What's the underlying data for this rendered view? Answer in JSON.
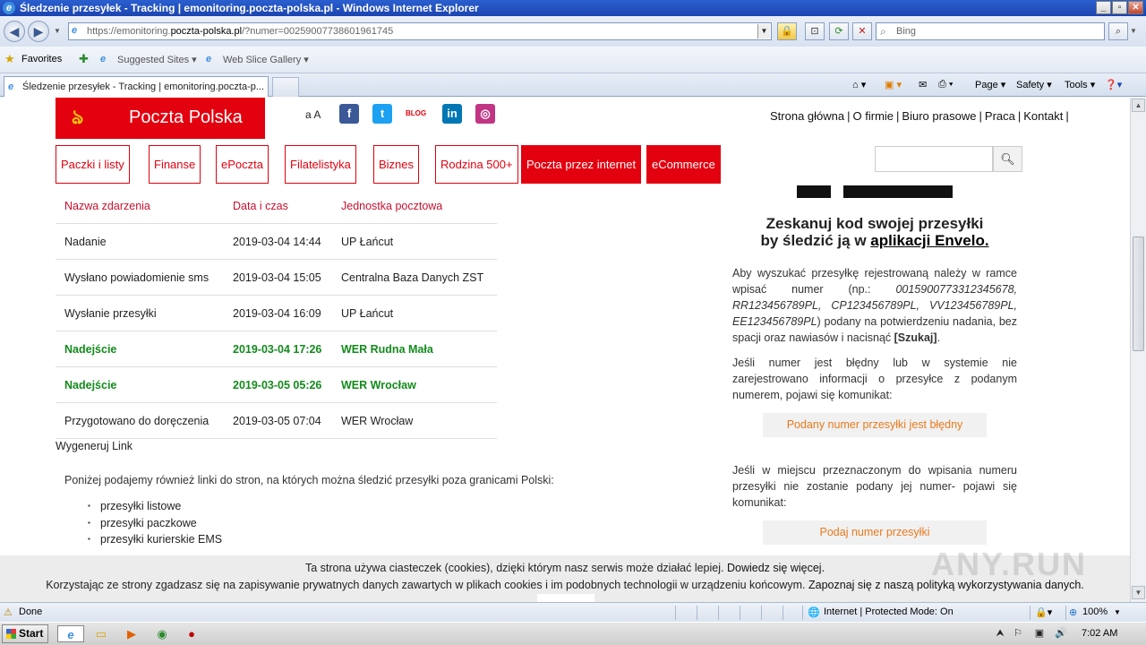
{
  "window": {
    "title": "Śledzenie przesyłek - Tracking | emonitoring.poczta-polska.pl - Windows Internet Explorer",
    "min": "_",
    "max": "▫",
    "close": "✕"
  },
  "addressbar": {
    "url_prefix": "https://emonitoring.",
    "url_domain": "poczta-polska.pl",
    "url_rest": "/?numer=00259007738601961745",
    "search_placeholder": "Bing"
  },
  "favorites": {
    "favorites_label": "Favorites",
    "suggested": "Suggested Sites ▾",
    "webslice": "Web Slice Gallery ▾"
  },
  "tabs": {
    "active_tab": "Śledzenie przesyłek - Tracking | emonitoring.poczta-p...",
    "commands": [
      "Page ▾",
      "Safety ▾",
      "Tools ▾"
    ]
  },
  "site": {
    "logo_text": "Poczta Polska",
    "font_toggle": "a A",
    "social": [
      {
        "icon": "facebook-icon",
        "glyph": "f",
        "color": "#3b5998"
      },
      {
        "icon": "twitter-icon",
        "glyph": "t",
        "color": "#1da1f2"
      },
      {
        "icon": "blog-icon",
        "glyph": "BLOG",
        "color": "#e3000f"
      },
      {
        "icon": "linkedin-icon",
        "glyph": "in",
        "color": "#0077b5"
      },
      {
        "icon": "instagram-icon",
        "glyph": "◎",
        "color": "#c13584"
      }
    ],
    "top_links": [
      "Strona główna",
      "O firmie",
      "Biuro prasowe",
      "Praca",
      "Kontakt"
    ],
    "menu": [
      {
        "label": "Paczki i listy",
        "active": false
      },
      {
        "label": "Finanse",
        "active": false
      },
      {
        "label": "ePoczta",
        "active": false
      },
      {
        "label": "Filatelistyka",
        "active": false
      },
      {
        "label": "Biznes",
        "active": false
      },
      {
        "label": "Rodzina 500+",
        "active": false
      },
      {
        "label": "Poczta przez internet",
        "active": true
      },
      {
        "label": "eCommerce",
        "active": true
      }
    ],
    "search_icon": "search-icon"
  },
  "events": {
    "headers": [
      "Nazwa zdarzenia",
      "Data i czas",
      "Jednostka pocztowa"
    ],
    "rows": [
      {
        "name": "Nadanie",
        "date": "2019-03-04 14:44",
        "unit": "UP Łańcut",
        "highlight": false
      },
      {
        "name": "Wysłano powiadomienie sms",
        "date": "2019-03-04 15:05",
        "unit": "Centralna Baza Danych ZST",
        "highlight": false
      },
      {
        "name": "Wysłanie przesyłki",
        "date": "2019-03-04 16:09",
        "unit": "UP Łańcut",
        "highlight": false
      },
      {
        "name": "Nadejście",
        "date": "2019-03-04 17:26",
        "unit": "WER Rudna Mała",
        "highlight": true
      },
      {
        "name": "Nadejście",
        "date": "2019-03-05 05:26",
        "unit": "WER Wrocław",
        "highlight": true
      },
      {
        "name": "Przygotowano do doręczenia",
        "date": "2019-03-05 07:04",
        "unit": "WER Wrocław",
        "highlight": false
      }
    ],
    "generate_link": "Wygeneruj Link"
  },
  "foreign": {
    "intro": "Poniżej podajemy również linki do stron, na których można śledzić przesyłki poza granicami Polski:",
    "items": [
      "przesyłki listowe",
      "przesyłki paczkowe",
      "przesyłki kurierskie EMS"
    ]
  },
  "sidebar": {
    "scan_line1": "Zeskanuj kod swojej przesyłki",
    "scan_line2_prefix": "by śledzić ją w ",
    "scan_line2_link": "aplikacji Envelo.",
    "p1_a": "Aby wyszukać przesyłkę rejestrowaną należy w ramce wpisać numer (np.: ",
    "p1_examples": "00159007733123456​78, RR123456789PL, CP123456789PL, VV123456789PL, EE123456789PL",
    "p1_b": ") podany na potwierdzeniu nadania, bez spacji oraz nawiasów i nacisnąć ",
    "p1_button": "[Szukaj]",
    "p1_end": ".",
    "p2": "Jeśli numer jest błędny lub w systemie nie zarejestrowano informacji o przesyłce z podanym numerem, pojawi się komunikat:",
    "msg1": "Podany numer przesyłki jest błędny",
    "p3": "Jeśli w miejscu przeznaczonym do wpisania numeru przesyłki nie zostanie podany jej numer- pojawi się komunikat:",
    "msg2": "Podaj numer przesyłki"
  },
  "cookie": {
    "line1_text": "Ta strona używa ciasteczek (cookies), dzięki którym nasz serwis może działać lepiej. ",
    "line1_link": "Dowiedz się więcej.",
    "line2_text": "Korzystając ze strony zgadzasz się na zapisywanie prywatnych danych zawartych w plikach cookies i im podobnych technologii w urządzeniu końcowym. ",
    "line2_link": "Zapoznaj się z naszą polityką wykorzystywania danych."
  },
  "watermark": "ANY.RUN",
  "statusbar": {
    "status": "Done",
    "zone": "Internet | Protected Mode: On",
    "zoom": "100%"
  },
  "taskbar": {
    "start": "Start",
    "clock": "7:02 AM"
  }
}
